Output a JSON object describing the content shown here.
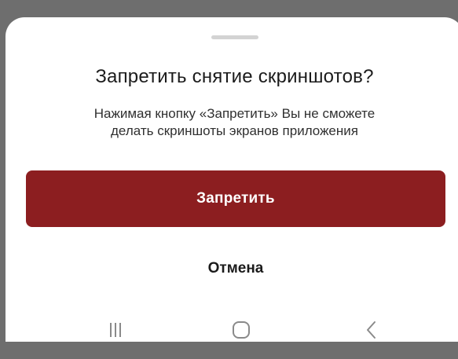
{
  "dialog": {
    "title": "Запретить снятие скриншотов?",
    "description_line1": "Нажимая кнопку «Запретить» Вы не сможете",
    "description_line2": "делать скриншоты экранов приложения",
    "confirm_label": "Запретить",
    "cancel_label": "Отмена"
  },
  "colors": {
    "backdrop": "#6e6e6e",
    "sheet": "#ffffff",
    "primary": "#8c1e20",
    "text": "#1b1b1b",
    "nav_icon": "#8a8a8a"
  },
  "navbar": {
    "icons": [
      "recents-icon",
      "home-icon",
      "back-icon"
    ]
  }
}
